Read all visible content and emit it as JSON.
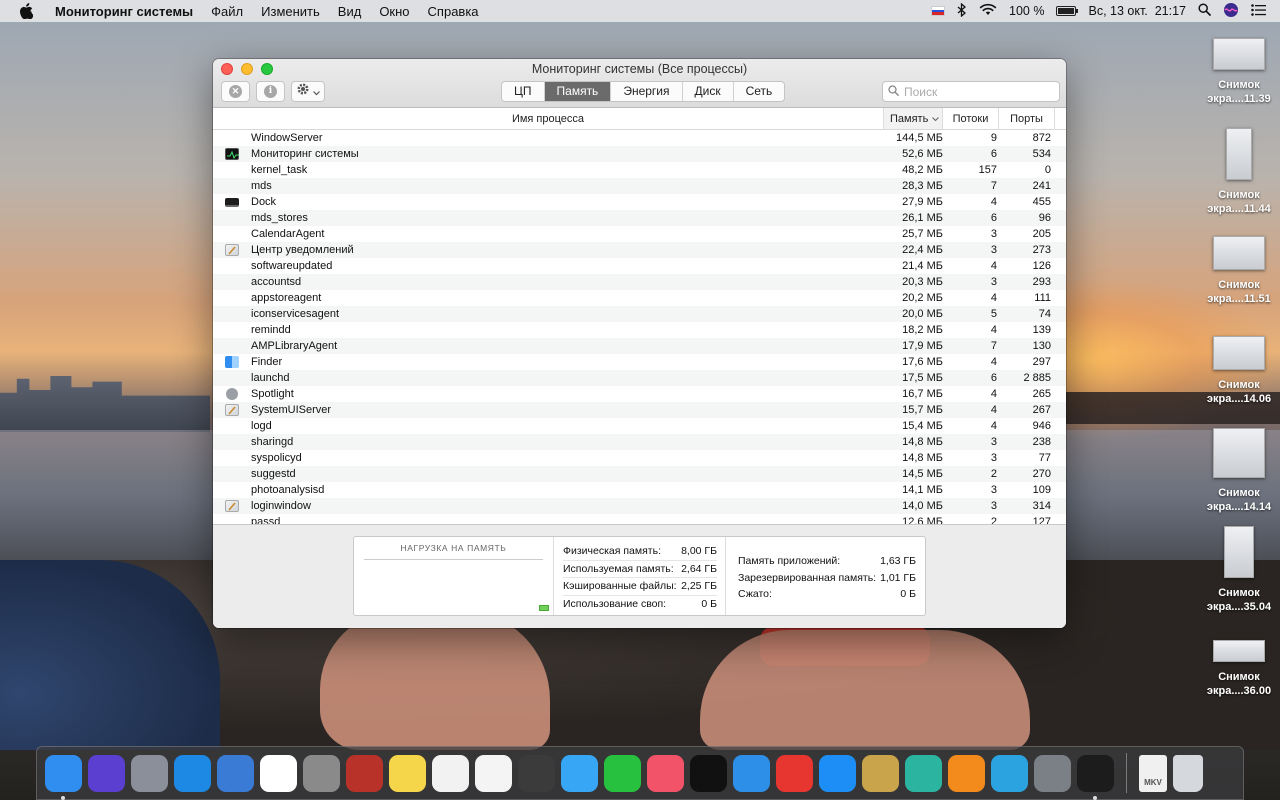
{
  "menubar": {
    "app_name": "Мониторинг системы",
    "menus": [
      "Файл",
      "Изменить",
      "Вид",
      "Окно",
      "Справка"
    ],
    "battery": "100 %",
    "datetime": "Вс, 13 окт.  21:17"
  },
  "window": {
    "title": "Мониторинг системы (Все процессы)",
    "tabs": [
      {
        "label": "ЦП",
        "active": false
      },
      {
        "label": "Память",
        "active": true
      },
      {
        "label": "Энергия",
        "active": false
      },
      {
        "label": "Диск",
        "active": false
      },
      {
        "label": "Сеть",
        "active": false
      }
    ],
    "search_placeholder": "Поиск",
    "columns": {
      "name": "Имя процесса",
      "memory": "Память",
      "threads": "Потоки",
      "ports": "Порты"
    },
    "processes": [
      {
        "icon": "none",
        "name": "WindowServer",
        "memory": "144,5 МБ",
        "threads": "9",
        "ports": "872"
      },
      {
        "icon": "activity-monitor",
        "name": "Мониторинг системы",
        "memory": "52,6 МБ",
        "threads": "6",
        "ports": "534"
      },
      {
        "icon": "none",
        "name": "kernel_task",
        "memory": "48,2 МБ",
        "threads": "157",
        "ports": "0"
      },
      {
        "icon": "none",
        "name": "mds",
        "memory": "28,3 МБ",
        "threads": "7",
        "ports": "241"
      },
      {
        "icon": "dock",
        "name": "Dock",
        "memory": "27,9 МБ",
        "threads": "4",
        "ports": "455"
      },
      {
        "icon": "none",
        "name": "mds_stores",
        "memory": "26,1 МБ",
        "threads": "6",
        "ports": "96"
      },
      {
        "icon": "none",
        "name": "CalendarAgent",
        "memory": "25,7 МБ",
        "threads": "3",
        "ports": "205"
      },
      {
        "icon": "generic-app",
        "name": "Центр уведомлений",
        "memory": "22,4 МБ",
        "threads": "3",
        "ports": "273"
      },
      {
        "icon": "none",
        "name": "softwareupdated",
        "memory": "21,4 МБ",
        "threads": "4",
        "ports": "126"
      },
      {
        "icon": "none",
        "name": "accountsd",
        "memory": "20,3 МБ",
        "threads": "3",
        "ports": "293"
      },
      {
        "icon": "none",
        "name": "appstoreagent",
        "memory": "20,2 МБ",
        "threads": "4",
        "ports": "111"
      },
      {
        "icon": "none",
        "name": "iconservicesagent",
        "memory": "20,0 МБ",
        "threads": "5",
        "ports": "74"
      },
      {
        "icon": "none",
        "name": "remindd",
        "memory": "18,2 МБ",
        "threads": "4",
        "ports": "139"
      },
      {
        "icon": "none",
        "name": "AMPLibraryAgent",
        "memory": "17,9 МБ",
        "threads": "7",
        "ports": "130"
      },
      {
        "icon": "finder",
        "name": "Finder",
        "memory": "17,6 МБ",
        "threads": "4",
        "ports": "297"
      },
      {
        "icon": "none",
        "name": "launchd",
        "memory": "17,5 МБ",
        "threads": "6",
        "ports": "2 885"
      },
      {
        "icon": "spotlight",
        "name": "Spotlight",
        "memory": "16,7 МБ",
        "threads": "4",
        "ports": "265"
      },
      {
        "icon": "generic-app",
        "name": "SystemUIServer",
        "memory": "15,7 МБ",
        "threads": "4",
        "ports": "267"
      },
      {
        "icon": "none",
        "name": "logd",
        "memory": "15,4 МБ",
        "threads": "4",
        "ports": "946"
      },
      {
        "icon": "none",
        "name": "sharingd",
        "memory": "14,8 МБ",
        "threads": "3",
        "ports": "238"
      },
      {
        "icon": "none",
        "name": "syspolicyd",
        "memory": "14,8 МБ",
        "threads": "3",
        "ports": "77"
      },
      {
        "icon": "none",
        "name": "suggestd",
        "memory": "14,5 МБ",
        "threads": "2",
        "ports": "270"
      },
      {
        "icon": "none",
        "name": "photoanalysisd",
        "memory": "14,1 МБ",
        "threads": "3",
        "ports": "109"
      },
      {
        "icon": "generic-app",
        "name": "loginwindow",
        "memory": "14,0 МБ",
        "threads": "3",
        "ports": "314"
      },
      {
        "icon": "none",
        "name": "passd",
        "memory": "12,6 МБ",
        "threads": "2",
        "ports": "127"
      }
    ],
    "memory_pressure": {
      "label": "НАГРУЗКА НА ПАМЯТЬ",
      "color": "#6fcf5a"
    },
    "stats_left": [
      {
        "label": "Физическая память:",
        "value": "8,00 ГБ"
      },
      {
        "label": "Используемая память:",
        "value": "2,64 ГБ"
      },
      {
        "label": "Кэшированные файлы:",
        "value": "2,25 ГБ"
      },
      {
        "label": "Использование своп:",
        "value": "0 Б"
      }
    ],
    "stats_right": [
      {
        "label": "Память приложений:",
        "value": "1,63 ГБ"
      },
      {
        "label": "Зарезервированная память:",
        "value": "1,01 ГБ"
      },
      {
        "label": "Сжато:",
        "value": "0 Б"
      }
    ]
  },
  "desktop_items": [
    {
      "line1": "Снимок",
      "line2": "экра....11.39"
    },
    {
      "line1": "Снимок",
      "line2": "экра....11.44"
    },
    {
      "line1": "Снимок",
      "line2": "экра....11.51"
    },
    {
      "line1": "Снимок",
      "line2": "экра....14.06"
    },
    {
      "line1": "Снимок",
      "line2": "экра....14.14"
    },
    {
      "line1": "Снимок",
      "line2": "экра....35.04"
    },
    {
      "line1": "Снимок",
      "line2": "экра....36.00"
    }
  ],
  "dock": [
    {
      "name": "finder",
      "color": "#2f8ef0",
      "running": true
    },
    {
      "name": "siri",
      "color": "#5b3fd0",
      "running": false
    },
    {
      "name": "launchpad",
      "color": "#8a8f99",
      "running": false
    },
    {
      "name": "safari",
      "color": "#1e88e5",
      "running": false
    },
    {
      "name": "mail-stamp",
      "color": "#3a7bd5",
      "running": false
    },
    {
      "name": "calendar",
      "color": "#ffffff",
      "running": false
    },
    {
      "name": "calculator",
      "color": "#8a8a8a",
      "running": false
    },
    {
      "name": "photo-booth",
      "color": "#b8322a",
      "running": false
    },
    {
      "name": "notes",
      "color": "#f5d54a",
      "running": false
    },
    {
      "name": "reminders",
      "color": "#f2f2f2",
      "running": false
    },
    {
      "name": "photos",
      "color": "#f4f4f4",
      "running": false
    },
    {
      "name": "layers-app",
      "color": "#3b3b3b",
      "running": false
    },
    {
      "name": "messages",
      "color": "#36a6f5",
      "running": false
    },
    {
      "name": "facetime",
      "color": "#27c13f",
      "running": false
    },
    {
      "name": "music",
      "color": "#f35369",
      "running": false
    },
    {
      "name": "apple-tv",
      "color": "#111111",
      "running": false
    },
    {
      "name": "maps-app",
      "color": "#2d8fe8",
      "running": false
    },
    {
      "name": "target-app",
      "color": "#e7362f",
      "running": false
    },
    {
      "name": "app-store",
      "color": "#1c8ef5",
      "running": false
    },
    {
      "name": "archive-utility",
      "color": "#c9a44a",
      "running": false
    },
    {
      "name": "downloader",
      "color": "#2bb4a0",
      "running": false
    },
    {
      "name": "vlc",
      "color": "#f38a1c",
      "running": false
    },
    {
      "name": "telegram",
      "color": "#2aa3e0",
      "running": false
    },
    {
      "name": "system-preferences",
      "color": "#7b7f86",
      "running": false
    },
    {
      "name": "activity-monitor",
      "color": "#1c1c1c",
      "running": true
    }
  ],
  "dock_trailing": [
    {
      "name": "mkv-file",
      "label": "MKV",
      "color": "#f0f0f0"
    },
    {
      "name": "trash",
      "color": "#d5d9de"
    }
  ]
}
